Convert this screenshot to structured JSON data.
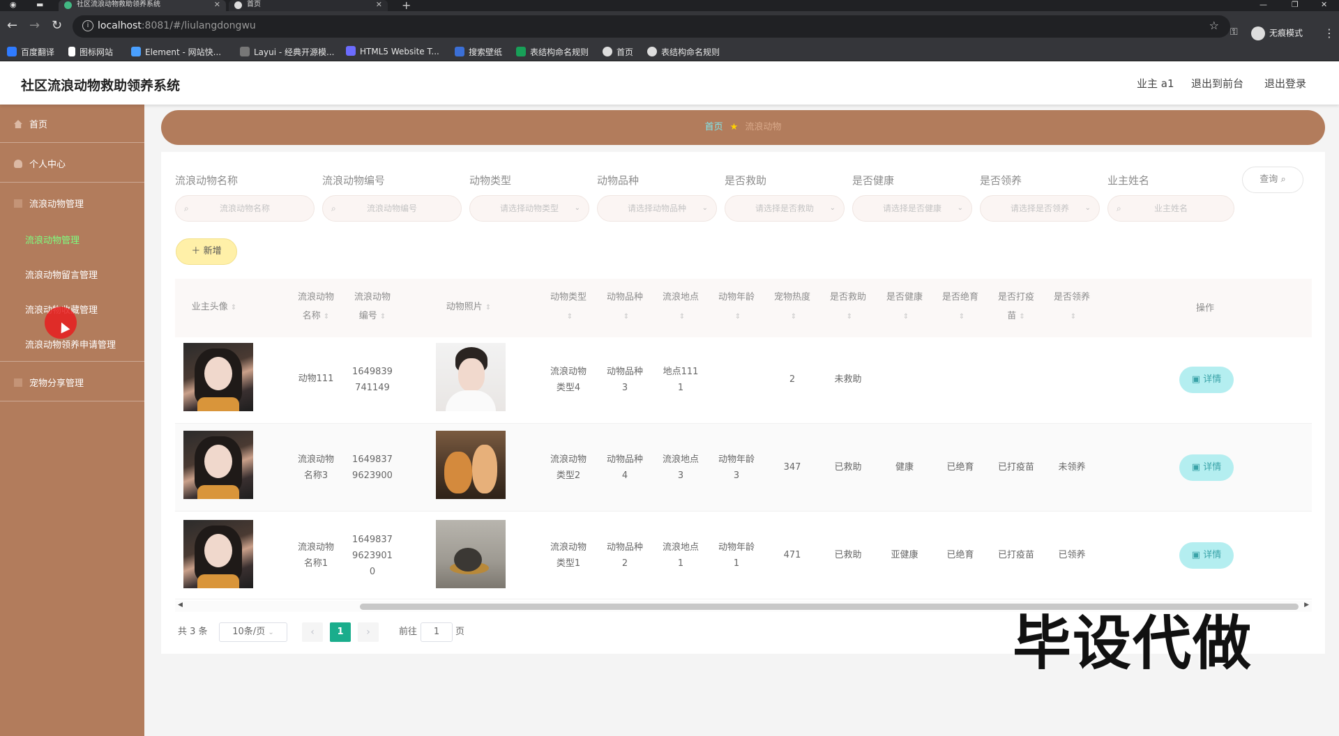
{
  "browser": {
    "tabs": [
      {
        "label": "社区流浪动物救助领养系统"
      },
      {
        "label": "首页"
      }
    ],
    "url_host": "localhost",
    "url_rest": ":8081/#/liulangdongwu",
    "incognito_label": "无痕模式",
    "bookmarks": [
      {
        "label": "百度翻译",
        "color": "#2f7bff"
      },
      {
        "label": "图标网站",
        "color": "#ffffff"
      },
      {
        "label": "Element - 网站快...",
        "color": "#4aa0ff"
      },
      {
        "label": "Layui - 经典开源模...",
        "color": "#cccccc"
      },
      {
        "label": "HTML5 Website T...",
        "color": "#6c6cff"
      },
      {
        "label": "搜索壁纸",
        "color": "#3b6fd6"
      },
      {
        "label": "表结构命名规则",
        "color": "#18a058"
      },
      {
        "label": "首页",
        "color": "#dddddd"
      },
      {
        "label": "表结构命名规则",
        "color": "#dddddd"
      }
    ]
  },
  "header": {
    "title": "社区流浪动物救助领养系统",
    "user": "业主 a1",
    "to_front": "退出到前台",
    "logout": "退出登录"
  },
  "sidebar": {
    "items": [
      {
        "label": "首页"
      },
      {
        "label": "个人中心"
      },
      {
        "label": "流浪动物管理"
      },
      {
        "label": "宠物分享管理"
      }
    ],
    "subitems": [
      {
        "label": "流浪动物管理",
        "active": true
      },
      {
        "label": "流浪动物留言管理"
      },
      {
        "label": "流浪动物收藏管理"
      },
      {
        "label": "流浪动物领养申请管理"
      }
    ]
  },
  "breadcrumb": {
    "home": "首页",
    "current": "流浪动物"
  },
  "filters": [
    {
      "label": "流浪动物名称",
      "placeholder": "流浪动物名称",
      "kind": "search"
    },
    {
      "label": "流浪动物编号",
      "placeholder": "流浪动物编号",
      "kind": "search"
    },
    {
      "label": "动物类型",
      "placeholder": "请选择动物类型",
      "kind": "select"
    },
    {
      "label": "动物品种",
      "placeholder": "请选择动物品种",
      "kind": "select"
    },
    {
      "label": "是否救助",
      "placeholder": "请选择是否救助",
      "kind": "select"
    },
    {
      "label": "是否健康",
      "placeholder": "请选择是否健康",
      "kind": "select"
    },
    {
      "label": "是否领养",
      "placeholder": "请选择是否领养",
      "kind": "select"
    },
    {
      "label": "业主姓名",
      "placeholder": "业主姓名",
      "kind": "search"
    }
  ],
  "query_label": "查询",
  "add_label": "新增",
  "table": {
    "columns": [
      {
        "l1": "业主头像",
        "l2": ""
      },
      {
        "l1": "流浪动物",
        "l2": "名称"
      },
      {
        "l1": "流浪动物",
        "l2": "编号"
      },
      {
        "l1": "动物照片",
        "l2": ""
      },
      {
        "l1": "动物类型",
        "l2": ""
      },
      {
        "l1": "动物品种",
        "l2": ""
      },
      {
        "l1": "流浪地点",
        "l2": ""
      },
      {
        "l1": "动物年龄",
        "l2": ""
      },
      {
        "l1": "宠物热度",
        "l2": ""
      },
      {
        "l1": "是否救助",
        "l2": ""
      },
      {
        "l1": "是否健康",
        "l2": ""
      },
      {
        "l1": "是否绝育",
        "l2": ""
      },
      {
        "l1": "是否打疫",
        "l2": "苗"
      },
      {
        "l1": "是否领养",
        "l2": ""
      },
      {
        "l1": "操作",
        "l2": ""
      }
    ],
    "rows": [
      {
        "name": [
          "动物111"
        ],
        "code": [
          "1649839",
          "741149"
        ],
        "type": [
          "流浪动物",
          "类型4"
        ],
        "breed": [
          "动物品种",
          "3"
        ],
        "place": [
          "地点111",
          "1"
        ],
        "age": [],
        "heat": "2",
        "rescued": "未救助",
        "healthy": "",
        "neutered": "",
        "vaccinated": "",
        "adopted": "",
        "photo": "p1"
      },
      {
        "name": [
          "流浪动物",
          "名称3"
        ],
        "code": [
          "1649837",
          "9623900"
        ],
        "type": [
          "流浪动物",
          "类型2"
        ],
        "breed": [
          "动物品种",
          "4"
        ],
        "place": [
          "流浪地点",
          "3"
        ],
        "age": [
          "动物年龄",
          "3"
        ],
        "heat": "347",
        "rescued": "已救助",
        "healthy": "健康",
        "neutered": "已绝育",
        "vaccinated": "已打疫苗",
        "adopted": "未领养",
        "photo": "p2"
      },
      {
        "name": [
          "流浪动物",
          "名称1"
        ],
        "code": [
          "1649837",
          "9623901",
          "0"
        ],
        "type": [
          "流浪动物",
          "类型1"
        ],
        "breed": [
          "动物品种",
          "2"
        ],
        "place": [
          "流浪地点",
          "1"
        ],
        "age": [
          "动物年龄",
          "1"
        ],
        "heat": "471",
        "rescued": "已救助",
        "healthy": "亚健康",
        "neutered": "已绝育",
        "vaccinated": "已打疫苗",
        "adopted": "已领养",
        "photo": "p3"
      }
    ],
    "detail_label": "详情"
  },
  "pagination": {
    "total": "共 3 条",
    "page_size": "10条/页",
    "current": "1",
    "goto_prefix": "前往",
    "goto_value": "1",
    "goto_suffix": "页"
  },
  "watermark": "毕设代做"
}
